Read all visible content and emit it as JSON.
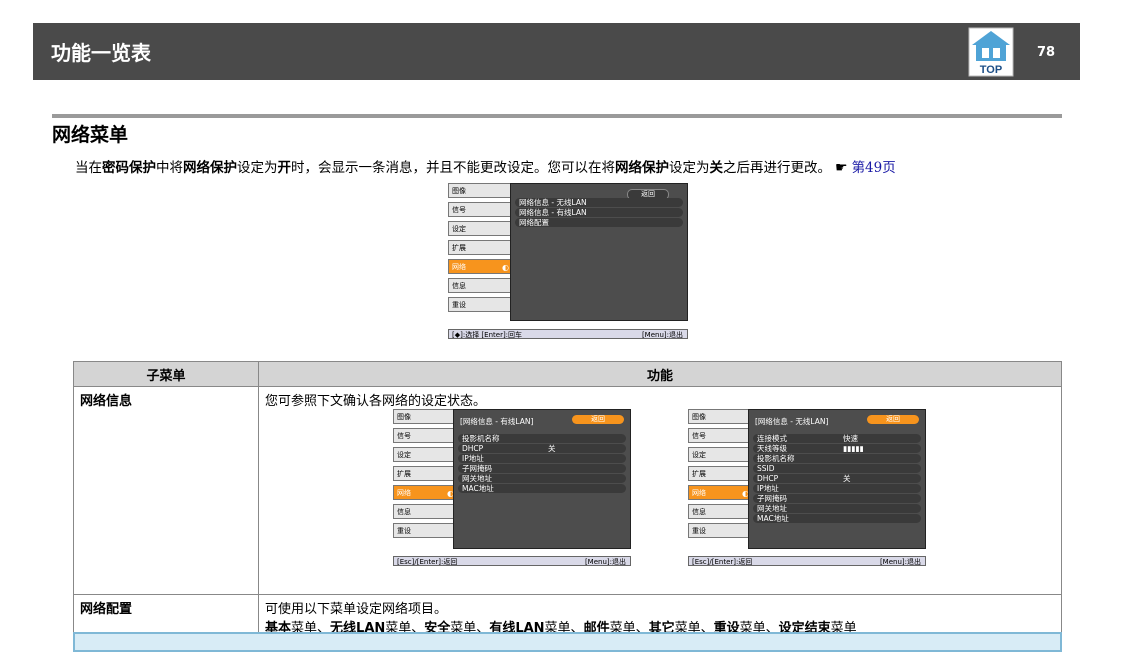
{
  "header": {
    "title": "功能一览表",
    "page_number": "78",
    "top_label": "TOP"
  },
  "section": {
    "title": "网络菜单"
  },
  "intro": {
    "p1": "当在",
    "b1": "密码保护",
    "p2": "中将",
    "b2": "网络保护",
    "p3": "设定为",
    "b3": "开",
    "p4": "时，会显示一条消息，并且不能更改设定。您可以在将",
    "b4": "网络保护",
    "p5": "设定为",
    "b5": "关",
    "p6": "之后再进行更改。",
    "hand": "☛",
    "link": "第49页"
  },
  "menu_main": {
    "tabs": [
      "图像",
      "信号",
      "设定",
      "扩展",
      "网络",
      "信息",
      "重设"
    ],
    "active_tab": "网络",
    "back": "返回",
    "items": [
      "网络信息 - 无线LAN",
      "网络信息 - 有线LAN",
      "网络配置"
    ],
    "status_left": "[◆]:选择 [Enter]:回车",
    "status_right": "[Menu]:退出"
  },
  "table": {
    "col1": "子菜单",
    "col2": "功能",
    "row1": {
      "key": "网络信息",
      "desc": "您可参照下文确认各网络的设定状态。"
    },
    "row2": {
      "key": "网络配置",
      "desc": "可使用以下菜单设定网络项目。",
      "list": [
        {
          "b": "基本",
          "t": "菜单、"
        },
        {
          "b": "无线LAN",
          "t": "菜单、"
        },
        {
          "b": "安全",
          "t": "菜单、"
        },
        {
          "b": "有线LAN",
          "t": "菜单、"
        },
        {
          "b": "邮件",
          "t": "菜单、"
        },
        {
          "b": "其它",
          "t": "菜单、"
        },
        {
          "b": "重设",
          "t": "菜单、"
        },
        {
          "b": "设定结束",
          "t": "菜单"
        }
      ]
    }
  },
  "menu_wired": {
    "tabs": [
      "图像",
      "信号",
      "设定",
      "扩展",
      "网络",
      "信息",
      "重设"
    ],
    "title": "[网络信息 - 有线LAN]",
    "back": "返回",
    "items": [
      {
        "label": "投影机名称",
        "value": ""
      },
      {
        "label": "DHCP",
        "value": "关"
      },
      {
        "label": "IP地址",
        "value": ""
      },
      {
        "label": "子网掩码",
        "value": ""
      },
      {
        "label": "网关地址",
        "value": ""
      },
      {
        "label": "MAC地址",
        "value": ""
      }
    ],
    "status_left": "[Esc]/[Enter]:返回",
    "status_right": "[Menu]:退出"
  },
  "menu_wireless": {
    "tabs": [
      "图像",
      "信号",
      "设定",
      "扩展",
      "网络",
      "信息",
      "重设"
    ],
    "title": "[网络信息 - 无线LAN]",
    "back": "返回",
    "items": [
      {
        "label": "连接模式",
        "value": "快速"
      },
      {
        "label": "天线等级",
        "value": "▮▮▮▮▮"
      },
      {
        "label": "投影机名称",
        "value": ""
      },
      {
        "label": "SSID",
        "value": ""
      },
      {
        "label": "DHCP",
        "value": "关"
      },
      {
        "label": "IP地址",
        "value": ""
      },
      {
        "label": "子网掩码",
        "value": ""
      },
      {
        "label": "网关地址",
        "value": ""
      },
      {
        "label": "MAC地址",
        "value": ""
      }
    ],
    "status_left": "[Esc]/[Enter]:返回",
    "status_right": "[Menu]:退出"
  },
  "colors": {
    "header_bg": "#4a4a4a",
    "accent": "#f7941d",
    "link": "#1a1aa6"
  }
}
